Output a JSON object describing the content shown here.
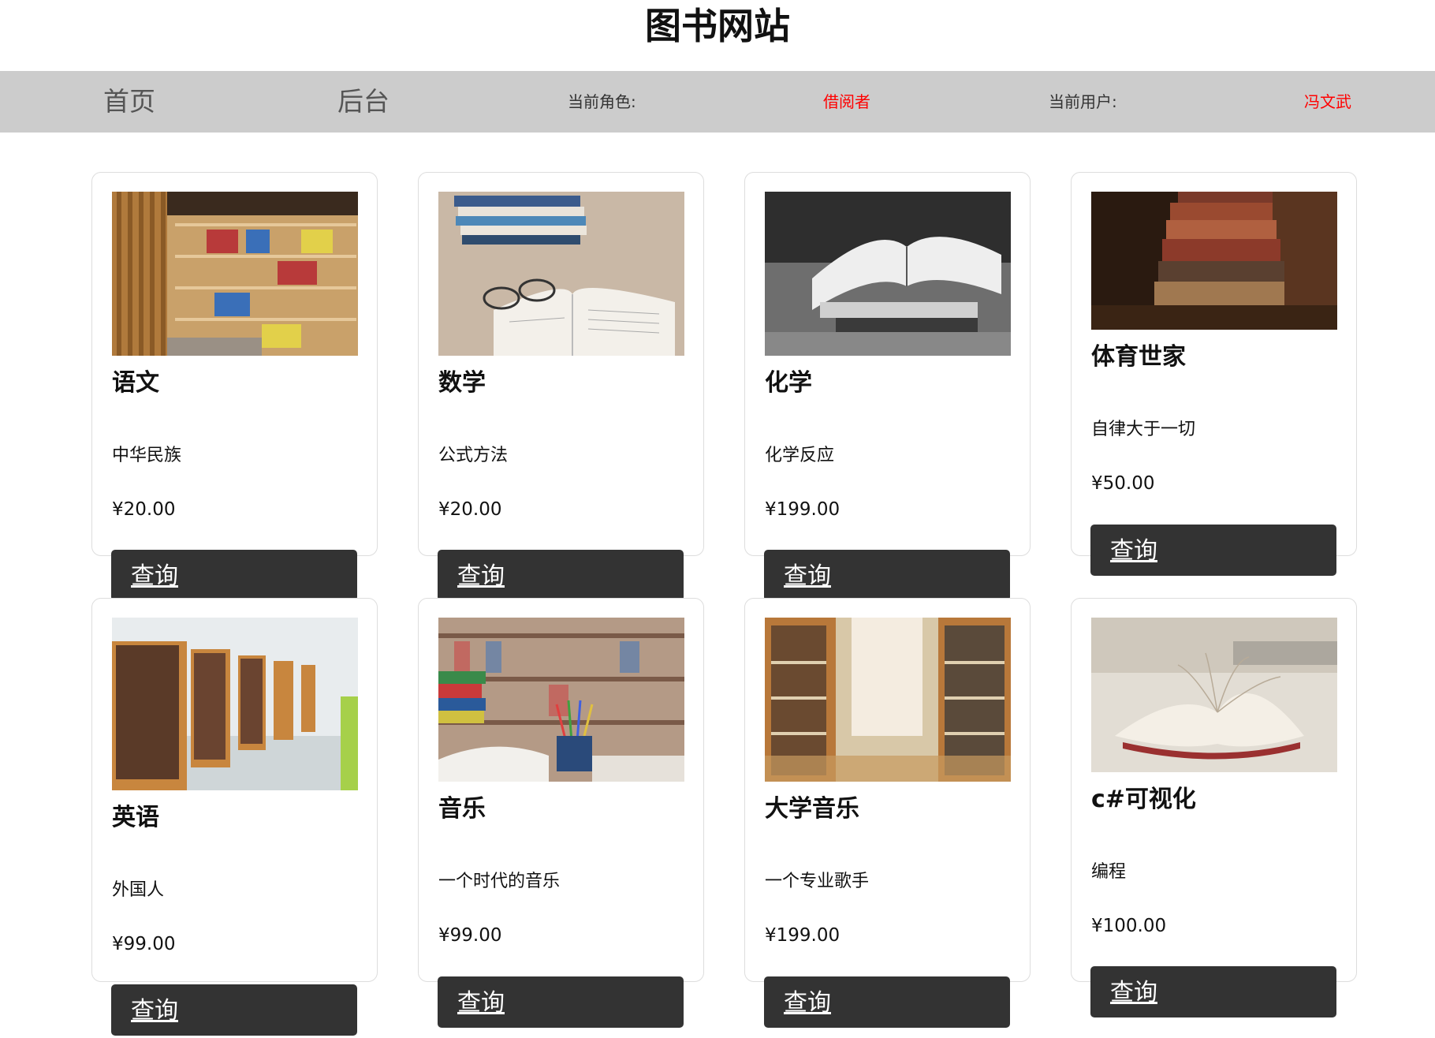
{
  "site": {
    "title": "图书网站"
  },
  "nav": {
    "home_label": "首页",
    "admin_label": "后台",
    "role_label": "当前角色:",
    "role_value": "借阅者",
    "user_label": "当前用户:",
    "user_value": "冯文武",
    "value_color": "#ff0000"
  },
  "books": [
    {
      "title": "语文",
      "description": "中华民族",
      "price": "¥20.00",
      "button_label": "查询",
      "image_icon": "library-curved-shelves-image"
    },
    {
      "title": "数学",
      "description": "公式方法",
      "price": "¥20.00",
      "button_label": "查询",
      "image_icon": "open-book-glasses-image"
    },
    {
      "title": "化学",
      "description": "化学反应",
      "price": "¥199.00",
      "button_label": "查询",
      "image_icon": "bw-open-books-image"
    },
    {
      "title": "体育世家",
      "description": "自律大于一切",
      "price": "¥50.00",
      "button_label": "查询",
      "image_icon": "old-book-stack-image"
    },
    {
      "title": "英语",
      "description": "外国人",
      "price": "¥99.00",
      "button_label": "查询",
      "image_icon": "library-shelves-aisle-image"
    },
    {
      "title": "音乐",
      "description": "一个时代的音乐",
      "price": "¥99.00",
      "button_label": "查询",
      "image_icon": "books-pencil-cup-image"
    },
    {
      "title": "大学音乐",
      "description": "一个专业歌手",
      "price": "¥199.00",
      "button_label": "查询",
      "image_icon": "library-hall-image"
    },
    {
      "title": "c#可视化",
      "description": "编程",
      "price": "¥100.00",
      "button_label": "查询",
      "image_icon": "open-book-pages-image"
    }
  ],
  "colors": {
    "navbar_bg": "#cccccc",
    "button_bg": "#333333",
    "card_border": "#dddddd"
  }
}
